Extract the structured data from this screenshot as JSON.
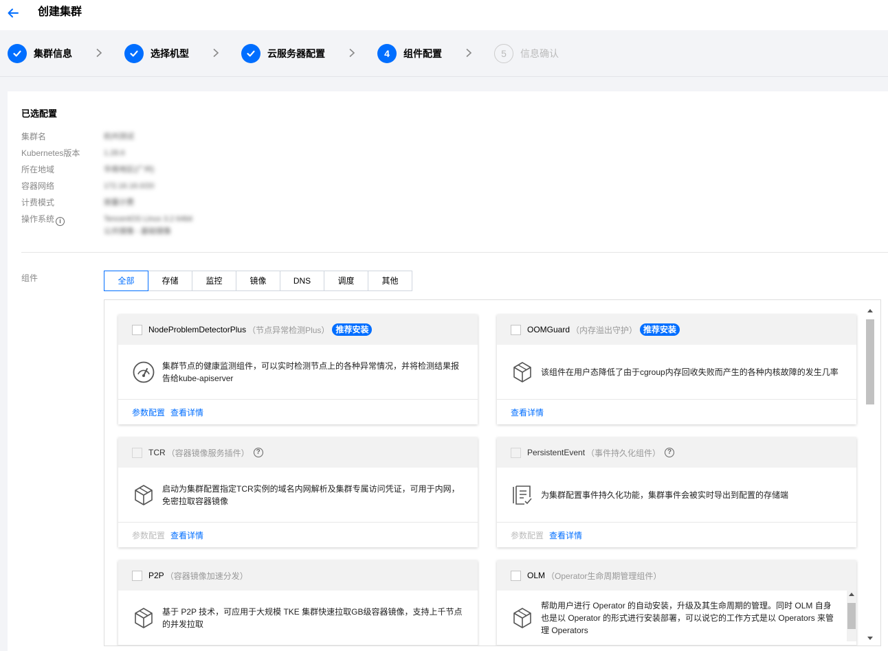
{
  "page": {
    "title": "创建集群"
  },
  "steps": [
    {
      "index": "1",
      "label": "集群信息",
      "state": "done"
    },
    {
      "index": "2",
      "label": "选择机型",
      "state": "done"
    },
    {
      "index": "3",
      "label": "云服务器配置",
      "state": "done"
    },
    {
      "index": "4",
      "label": "组件配置",
      "state": "current"
    },
    {
      "index": "5",
      "label": "信息确认",
      "state": "pending"
    }
  ],
  "summary": {
    "title": "已选配置",
    "rows": [
      {
        "label": "集群名",
        "value": "杭州测试"
      },
      {
        "label": "Kubernetes版本",
        "value": "1.28.6"
      },
      {
        "label": "所在地域",
        "value": "华南地区(广州)"
      },
      {
        "label": "容器网络",
        "value": "172.16.16.0/20"
      },
      {
        "label": "计费模式",
        "value": "按量计费"
      },
      {
        "label": "操作系统",
        "value": "TencentOS Linux 3.2 64bit",
        "value2": "公共镜像 - 基础镜像"
      }
    ]
  },
  "components": {
    "label": "组件",
    "tabs": [
      "全部",
      "存储",
      "监控",
      "镜像",
      "DNS",
      "调度",
      "其他"
    ],
    "active_tab": "全部",
    "badge_label": "推荐安装",
    "cards": [
      {
        "name": "NodeProblemDetectorPlus",
        "sub": "（节点异常检测Plus）",
        "badge": true,
        "help": false,
        "disabled": false,
        "icon": "gauge-icon",
        "desc": "集群节点的健康监测组件，可以实时检测节点上的各种异常情况，并将检测结果报告给kube-apiserver",
        "links": [
          {
            "label": "参数配置",
            "disabled": false
          },
          {
            "label": "查看详情",
            "disabled": false
          }
        ]
      },
      {
        "name": "OOMGuard",
        "sub": "（内存溢出守护）",
        "badge": true,
        "help": false,
        "disabled": false,
        "icon": "cube-icon",
        "desc": "该组件在用户态降低了由于cgroup内存回收失败而产生的各种内核故障的发生几率",
        "links": [
          {
            "label": "查看详情",
            "disabled": false
          }
        ]
      },
      {
        "name": "TCR",
        "sub": "（容器镜像服务插件）",
        "badge": false,
        "help": true,
        "disabled": true,
        "icon": "cube-icon",
        "desc": "启动为集群配置指定TCR实例的域名内网解析及集群专属访问凭证，可用于内网，免密拉取容器镜像",
        "links": [
          {
            "label": "参数配置",
            "disabled": true
          },
          {
            "label": "查看详情",
            "disabled": false
          }
        ]
      },
      {
        "name": "PersistentEvent",
        "sub": "（事件持久化组件）",
        "badge": false,
        "help": true,
        "disabled": true,
        "icon": "document-check-icon",
        "desc": "为集群配置事件持久化功能，集群事件会被实时导出到配置的存储端",
        "links": [
          {
            "label": "参数配置",
            "disabled": true
          },
          {
            "label": "查看详情",
            "disabled": false
          }
        ]
      },
      {
        "name": "P2P",
        "sub": "（容器镜像加速分发）",
        "badge": false,
        "help": false,
        "disabled": false,
        "icon": "cube-icon",
        "desc": "基于 P2P 技术，可应用于大规模 TKE 集群快速拉取GB级容器镜像，支持上千节点的并发拉取",
        "links": []
      },
      {
        "name": "OLM",
        "sub": "（Operator生命周期管理组件）",
        "badge": false,
        "help": false,
        "disabled": false,
        "icon": "cube-icon",
        "desc": "帮助用户进行 Operator 的自动安装，升级及其生命周期的管理。同时 OLM 自身也是以 Operator 的形式进行安装部署，可以说它的工作方式是以 Operators 来管理 Operators",
        "links": []
      }
    ]
  },
  "colors": {
    "primary": "#006eff",
    "muted": "#888888",
    "disabled": "#bbbbbb"
  }
}
